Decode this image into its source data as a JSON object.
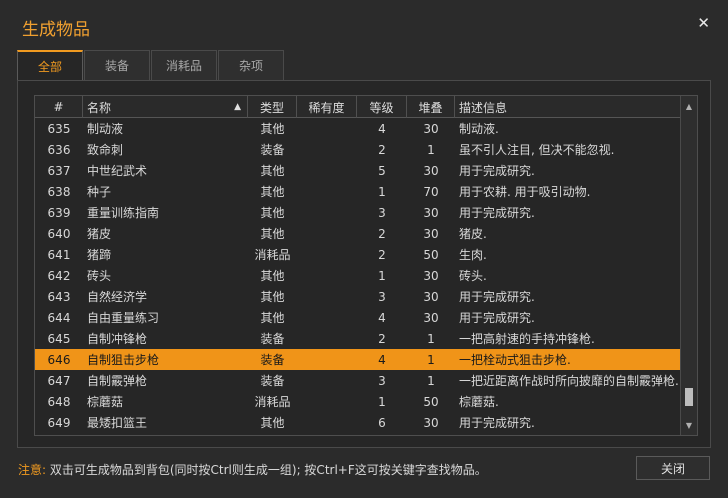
{
  "window": {
    "title": "生成物品"
  },
  "tabs": [
    "全部",
    "装备",
    "消耗品",
    "杂项"
  ],
  "columns": [
    "#",
    "名称",
    "类型",
    "稀有度",
    "等级",
    "堆叠",
    "描述信息"
  ],
  "rows": [
    [
      "635",
      "制动液",
      "其他",
      "",
      "4",
      "30",
      "制动液."
    ],
    [
      "636",
      "致命刺",
      "装备",
      "",
      "2",
      "1",
      "虽不引人注目, 但决不能忽视."
    ],
    [
      "637",
      "中世纪武术",
      "其他",
      "",
      "5",
      "30",
      "用于完成研究."
    ],
    [
      "638",
      "种子",
      "其他",
      "",
      "1",
      "70",
      "用于农耕. 用于吸引动物."
    ],
    [
      "639",
      "重量训练指南",
      "其他",
      "",
      "3",
      "30",
      "用于完成研究."
    ],
    [
      "640",
      "猪皮",
      "其他",
      "",
      "2",
      "30",
      "猪皮."
    ],
    [
      "641",
      "猪蹄",
      "消耗品",
      "",
      "2",
      "50",
      "生肉."
    ],
    [
      "642",
      "砖头",
      "其他",
      "",
      "1",
      "30",
      "砖头."
    ],
    [
      "643",
      "自然经济学",
      "其他",
      "",
      "3",
      "30",
      "用于完成研究."
    ],
    [
      "644",
      "自由重量练习",
      "其他",
      "",
      "4",
      "30",
      "用于完成研究."
    ],
    [
      "645",
      "自制冲锋枪",
      "装备",
      "",
      "2",
      "1",
      "一把高射速的手持冲锋枪."
    ],
    [
      "646",
      "自制狙击步枪",
      "装备",
      "",
      "4",
      "1",
      "一把栓动式狙击步枪."
    ],
    [
      "647",
      "自制霰弹枪",
      "装备",
      "",
      "3",
      "1",
      "一把近距离作战时所向披靡的自制霰弹枪."
    ],
    [
      "648",
      "棕蘑菇",
      "消耗品",
      "",
      "1",
      "50",
      "棕蘑菇."
    ],
    [
      "649",
      "最矮扣篮王",
      "其他",
      "",
      "6",
      "30",
      "用于完成研究."
    ]
  ],
  "selected_index": 11,
  "scrollbar": {
    "position": 0.96
  },
  "footer": {
    "note_label": "注意:",
    "note_text": " 双击可生成物品到背包(同时按Ctrl则生成一组); 按Ctrl+F这可按关键字查找物品。",
    "close_label": "关闭"
  },
  "icons": {
    "close": "close-icon",
    "sort": "sort-up-icon",
    "scroll_up": "scroll-up-icon",
    "scroll_down": "scroll-down-icon"
  }
}
